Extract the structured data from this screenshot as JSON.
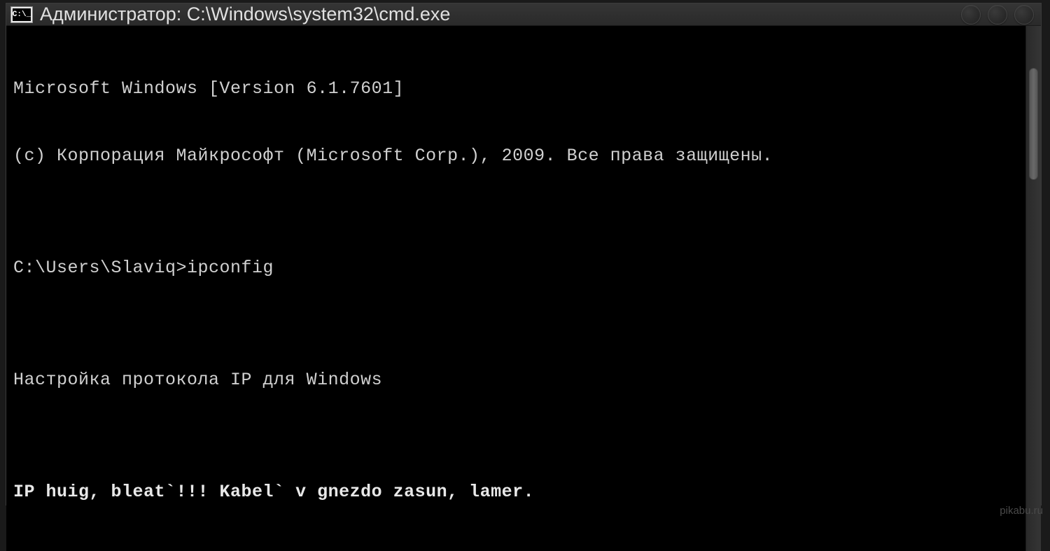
{
  "window": {
    "icon_label": "C:\\_",
    "title": "Администратор: C:\\Windows\\system32\\cmd.exe"
  },
  "console": {
    "lines": [
      "Microsoft Windows [Version 6.1.7601]",
      "(c) Корпорация Майкрософт (Microsoft Corp.), 2009. Все права защищены.",
      "",
      "C:\\Users\\Slaviq>ipconfig",
      "",
      "Настройка протокола IP для Windows",
      "",
      "IP huig, bleat`!!! Kabel` v gnezdo zasun, lamer."
    ]
  },
  "watermark": "pikabu.ru"
}
